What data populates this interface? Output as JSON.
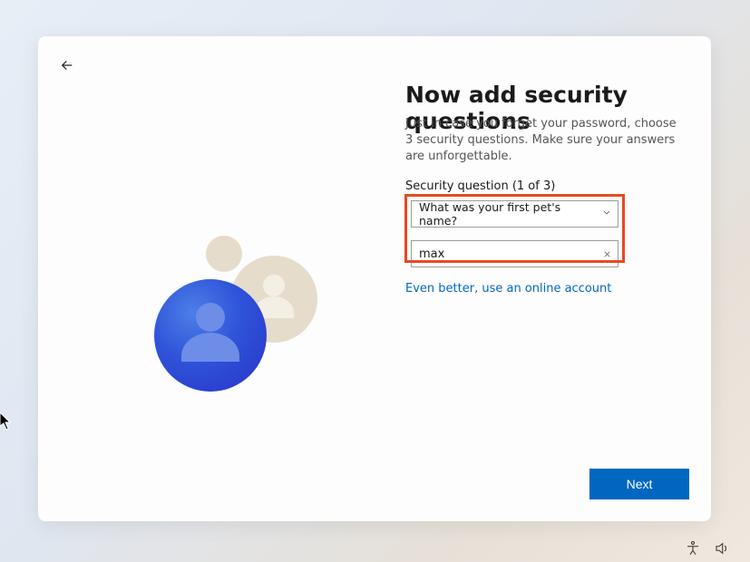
{
  "header": {
    "title": "Now add security questions",
    "subtitle": "Just in case you forget your password, choose 3 security questions. Make sure your answers are unforgettable."
  },
  "question": {
    "label": "Security question (1 of 3)",
    "selected": "What was your first pet's name?",
    "answer": "max"
  },
  "link_text": "Even better, use an online account",
  "buttons": {
    "next": "Next"
  }
}
